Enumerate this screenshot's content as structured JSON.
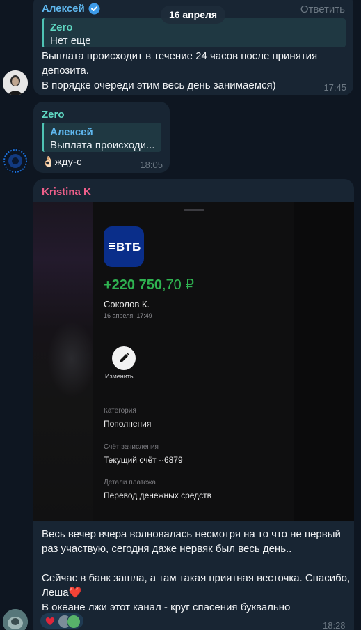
{
  "date_separator": "16 апреля",
  "messages": [
    {
      "sender": "Алексей",
      "verified": true,
      "reply_action": "Ответить",
      "reply": {
        "name": "Zero",
        "text": "Нет еще"
      },
      "text_lines": [
        "Выплата происходит в течение 24 часов после принятия",
        "депозита.",
        "В порядке очереди этим весь день занимаемся)"
      ],
      "time": "17:45"
    },
    {
      "sender": "Zero",
      "reply": {
        "name": "Алексей",
        "text": "Выплата происходи..."
      },
      "text": "👌🏻жду-с",
      "time": "18:05"
    },
    {
      "sender": "Kristina K",
      "screenshot": {
        "bank_logo": "ВТБ",
        "amount_main": "+220 750",
        "amount_decimal": ",70 ₽",
        "payee": "Соколов К.",
        "date": "16 апреля, 17:49",
        "edit_label": "Изменить...",
        "fields": [
          {
            "label": "Категория",
            "value": "Пополнения"
          },
          {
            "label": "Счёт зачисления",
            "value": "Текущий счёт ··6879"
          },
          {
            "label": "Детали платежа",
            "value": "Перевод денежных средств"
          }
        ]
      },
      "text_lines": [
        "Весь вечер вчера волновалась несмотря на то что не первый",
        "раз участвую, сегодня даже нервяк был весь день..",
        "",
        "Сейчас в банк зашла, а там такая приятная весточка. Спасибо,",
        "Леша❤️",
        "В океане лжи этот канал - круг спасения буквально"
      ],
      "reaction": "❤️",
      "time": "18:28"
    }
  ],
  "colors": {
    "background": "#0e1621",
    "bubble": "#182533",
    "sender_aleksey": "#5fb7ee",
    "sender_zero": "#5fd7c2",
    "sender_kristina": "#ee5f8a",
    "amount_green": "#2fb351",
    "vtb_blue": "#0a2e8a"
  },
  "icons": [
    "verified-badge-icon",
    "pencil-icon",
    "heart-icon"
  ]
}
